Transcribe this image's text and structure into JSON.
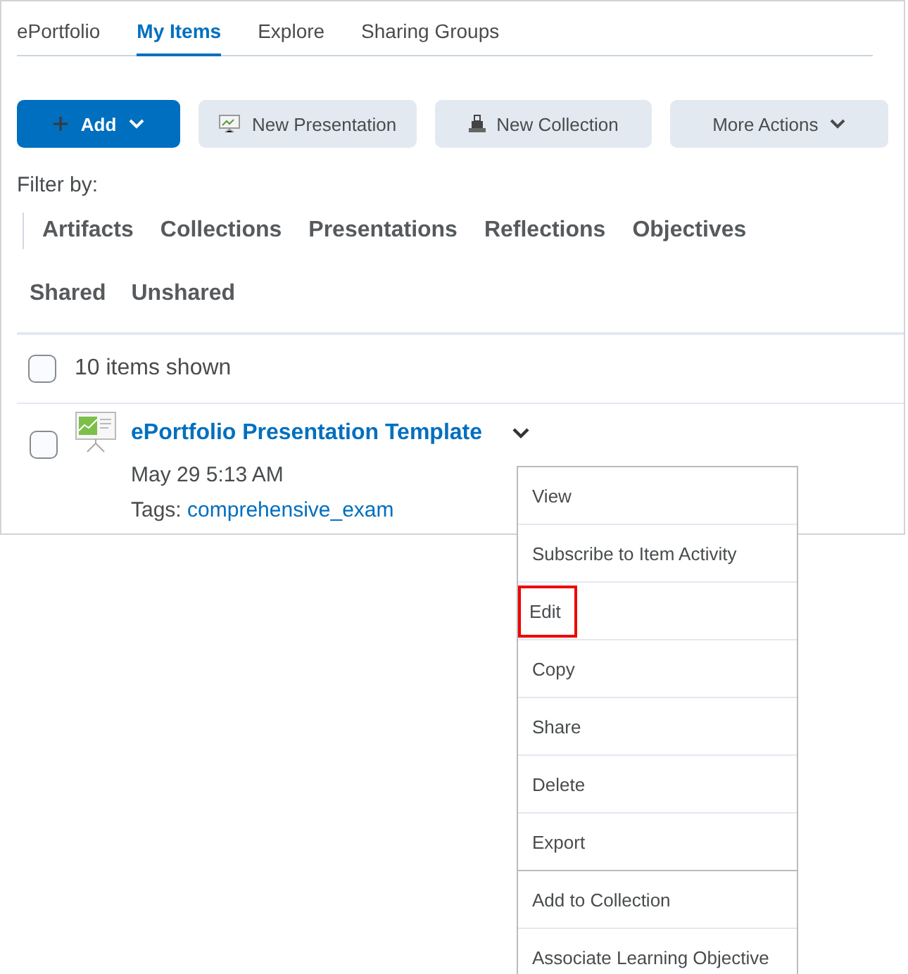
{
  "tabs": [
    {
      "label": "ePortfolio",
      "selected": false
    },
    {
      "label": "My Items",
      "selected": true
    },
    {
      "label": "Explore",
      "selected": false
    },
    {
      "label": "Sharing Groups",
      "selected": false
    }
  ],
  "actions": [
    {
      "label": "Add",
      "kind": "primary"
    },
    {
      "label": "New Presentation",
      "kind": "presentation"
    },
    {
      "label": "New Collection",
      "kind": "collection"
    },
    {
      "label": "More Actions",
      "kind": "dropdown"
    }
  ],
  "filter_label": "Filter by:",
  "filters": [
    "Artifacts",
    "Collections",
    "Presentations",
    "Reflections",
    "Objectives"
  ],
  "share_filters": [
    "Shared",
    "Unshared"
  ],
  "select_all": {
    "label": "10 items shown",
    "checked": false
  },
  "item": {
    "title": "ePortfolio Presentation Template",
    "date": "May 29 5:13 AM",
    "tags_label": "Tags:",
    "tag": "comprehensive_exam",
    "checked": false
  },
  "menu": [
    {
      "label": "View",
      "highlighted": false
    },
    {
      "label": "Subscribe to Item Activity",
      "highlighted": false
    },
    {
      "label": "Edit",
      "highlighted": true
    },
    {
      "label": "Copy",
      "highlighted": false
    },
    {
      "label": "Share",
      "highlighted": false
    },
    {
      "label": "Delete",
      "highlighted": false
    },
    {
      "label": "Export",
      "highlighted": false
    },
    {
      "label": "Add to Collection",
      "highlighted": false
    },
    {
      "label": "Associate Learning Objective",
      "highlighted": false
    }
  ]
}
